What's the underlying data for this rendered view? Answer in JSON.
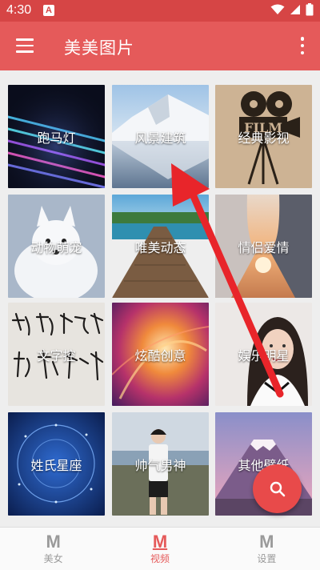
{
  "status": {
    "time": "4:30",
    "notif_letter": "A"
  },
  "app_bar": {
    "title": "美美图片"
  },
  "categories": [
    {
      "label": "跑马灯",
      "theme": "neon-lights"
    },
    {
      "label": "风景建筑",
      "theme": "snow-mountain-lake"
    },
    {
      "label": "经典影视",
      "theme": "film-camera"
    },
    {
      "label": "动物萌宠",
      "theme": "arctic-fox"
    },
    {
      "label": "唯美动态",
      "theme": "wooden-pier"
    },
    {
      "label": "情侣爱情",
      "theme": "couple-hands"
    },
    {
      "label": "文字控",
      "theme": "calligraphy"
    },
    {
      "label": "炫酷创意",
      "theme": "abstract-swirl"
    },
    {
      "label": "娱乐明星",
      "theme": "celebrity-portrait"
    },
    {
      "label": "姓氏星座",
      "theme": "zodiac-blue"
    },
    {
      "label": "帅气男神",
      "theme": "man-coast"
    },
    {
      "label": "其他壁纸",
      "theme": "fuji-sunset"
    }
  ],
  "fab": {
    "icon": "search-icon"
  },
  "bottom_nav": [
    {
      "glyph": "M",
      "label": "美女",
      "active": false
    },
    {
      "glyph": "M",
      "label": "视频",
      "active": true
    },
    {
      "glyph": "M",
      "label": "设置",
      "active": false
    }
  ],
  "colors": {
    "primary": "#e55a5a",
    "status_bar": "#d64545",
    "accent_fab": "#e84a4a",
    "annotation_arrow": "#e8252a"
  }
}
